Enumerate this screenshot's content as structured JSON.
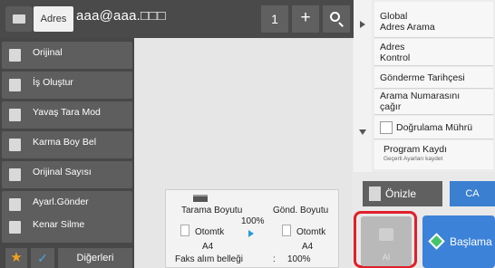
{
  "address_bar": {
    "tab_label": "Adres",
    "address_value": "aaa@aaa.□□□",
    "count": "1",
    "plus_icon": "plus-icon",
    "search_icon": "search-icon"
  },
  "left_panel": {
    "items": [
      {
        "label": "Orijinal",
        "icon": "original-icon"
      },
      {
        "label": "İş Oluştur",
        "icon": "job-build-icon"
      },
      {
        "label": "Yavaş Tara Mod",
        "icon": "slow-scan-icon"
      },
      {
        "label": "Karma Boy Bel",
        "icon": "mixed-size-icon"
      },
      {
        "label": "Orijinal Sayısı",
        "icon": "original-count-icon"
      },
      {
        "label": "Ayarl.Gönder",
        "icon": "send-settings-icon"
      },
      {
        "label": "Kenar Silme",
        "icon": "erase-icon"
      }
    ],
    "bottom": {
      "star_icon": "★",
      "check_icon": "✓",
      "others_label": "Diğerleri"
    }
  },
  "right_menu": {
    "items": [
      {
        "line1": "Global",
        "line2": "Adres Arama"
      },
      {
        "line1": "Adres",
        "line2": "Kontrol"
      },
      {
        "line1": "Gönderme Tarihçesi",
        "line2": ""
      },
      {
        "line1": "Arama Numarasını",
        "line2": "çağır"
      },
      {
        "line1": "Doğrulama Mührü",
        "line2": ""
      },
      {
        "line1": "Program Kaydı",
        "line2": "Geçerli Ayarları kaydet"
      }
    ]
  },
  "preview_label": "Önizle",
  "ca_label": "CA",
  "status_panel": {
    "scan_size_label": "Tarama Boyutu",
    "send_size_label": "Gönd. Boyutu",
    "scan_mode": "Otomtk",
    "send_mode": "Otomtk",
    "ratio": "100%",
    "scan_paper": "A4",
    "send_paper": "A4",
    "fax_memory_label": "Faks alım belleği",
    "fax_memory_sep": ":",
    "fax_memory_value": "100%"
  },
  "ai_label": "AI",
  "start_label": "Başlama",
  "colors": {
    "accent_blue": "#3c82d8",
    "highlight_red": "#e0202a",
    "start_icon_green": "#44c46a",
    "star_orange": "#f0a020"
  }
}
